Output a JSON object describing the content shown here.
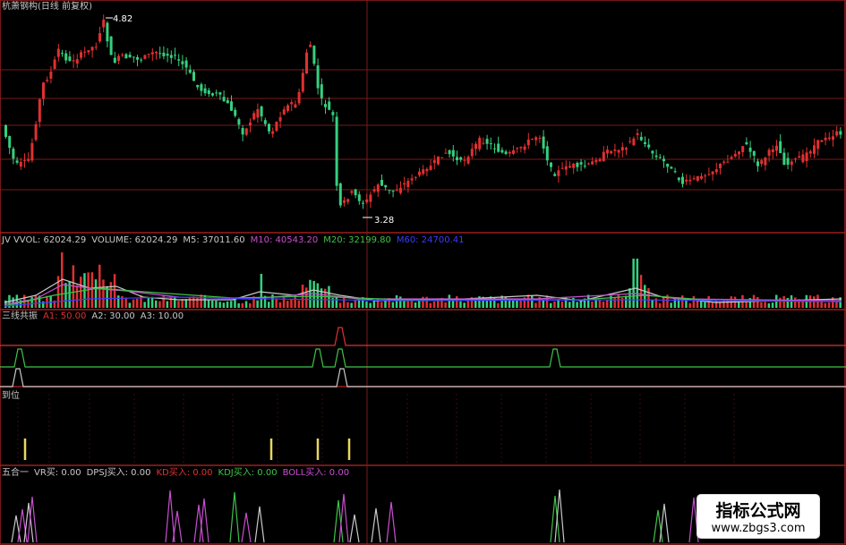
{
  "title": "杭萧钢构(日线 前复权)",
  "price_panel": {
    "high_label": "4.82",
    "low_label": "3.28"
  },
  "vol_panel": {
    "items": [
      {
        "text": "JV VVOL: 62024.29",
        "color": "#c8c8c8"
      },
      {
        "text": "VOLUME: 62024.29",
        "color": "#c8c8c8"
      },
      {
        "text": "M5: 37011.60",
        "color": "#c8c8c8"
      },
      {
        "text": "M10: 40543.20",
        "color": "#c84fd0"
      },
      {
        "text": "M20: 32199.80",
        "color": "#3fc24a"
      },
      {
        "text": "M60: 24700.41",
        "color": "#3a3cff"
      }
    ]
  },
  "sanxian_panel": {
    "items": [
      {
        "text": "三线共振",
        "color": "#c8c8c8"
      },
      {
        "text": "A1: 50.00",
        "color": "#e03030"
      },
      {
        "text": "A2: 30.00",
        "color": "#c8c8c8"
      },
      {
        "text": "A3: 10.00",
        "color": "#c8c8c8"
      }
    ]
  },
  "daowei_panel": {
    "label": "到位"
  },
  "wuheyi_panel": {
    "items": [
      {
        "text": "五合一",
        "color": "#c8c8c8"
      },
      {
        "text": "VR买: 0.00",
        "color": "#c8c8c8"
      },
      {
        "text": "DPSJ买入: 0.00",
        "color": "#c8c8c8"
      },
      {
        "text": "KD买入: 0.00",
        "color": "#e03030"
      },
      {
        "text": "KDJ买入: 0.00",
        "color": "#3fc24a"
      },
      {
        "text": "BOLL买入: 0.00",
        "color": "#c84fd0"
      }
    ]
  },
  "watermark": {
    "title": "指标公式网",
    "url": "www.zbgs3.com"
  },
  "colors": {
    "up": "#e03030",
    "down": "#35d07f",
    "grid": "#7a1a1a",
    "panel_border": "#9a1f1f"
  }
}
